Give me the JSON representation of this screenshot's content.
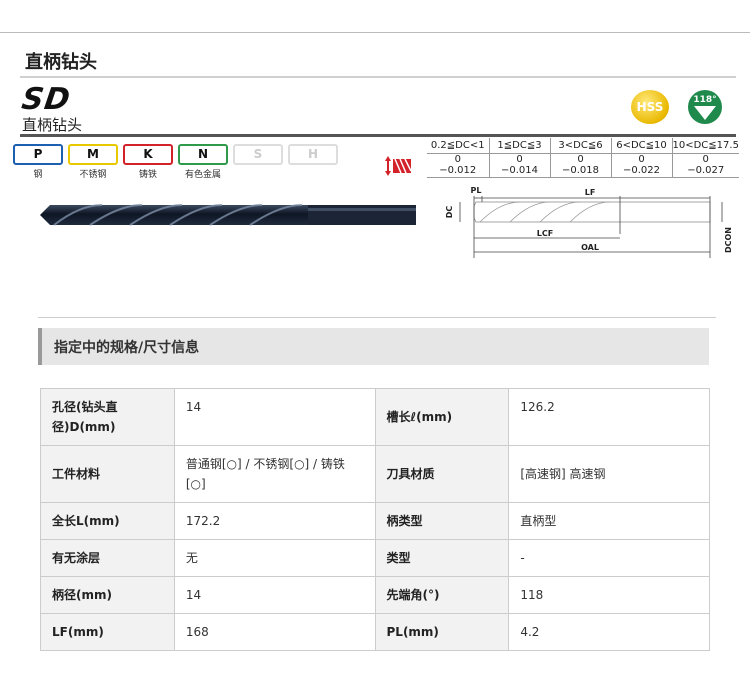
{
  "page": {
    "title": "直柄钻头"
  },
  "product": {
    "code": "SD",
    "name": "直柄钻头",
    "material_badge": "HSS",
    "point_angle_badge": "118°"
  },
  "materials": [
    {
      "code": "P",
      "label": "钢",
      "color": "#1d5fb0",
      "active": true
    },
    {
      "code": "M",
      "label": "不锈钢",
      "color": "#e8c900",
      "active": true
    },
    {
      "code": "K",
      "label": "铸铁",
      "color": "#d3222a",
      "active": true
    },
    {
      "code": "N",
      "label": "有色金属",
      "color": "#2f9a4a",
      "active": true
    },
    {
      "code": "S",
      "label": "",
      "color": "#dddddd",
      "active": false
    },
    {
      "code": "H",
      "label": "",
      "color": "#dddddd",
      "active": false
    }
  ],
  "tolerance": {
    "headers": [
      "0.2≦DC<1",
      "1≦DC≦3",
      "3<DC≦6",
      "6<DC≦10",
      "10<DC≦17.5"
    ],
    "upper": [
      "0",
      "0",
      "0",
      "0",
      "0"
    ],
    "lower": [
      "−0.012",
      "−0.014",
      "−0.018",
      "−0.022",
      "−0.027"
    ]
  },
  "diagram_labels": {
    "pl": "PL",
    "lf": "LF",
    "lcf": "LCF",
    "oal": "OAL",
    "dc": "DC",
    "dcon": "DCON"
  },
  "section": {
    "title": "指定中的规格/尺寸信息"
  },
  "specs": {
    "hole_dia_label": "孔径(钻头直径)D(mm)",
    "hole_dia_value": "14",
    "flute_len_label": "槽长ℓ(mm)",
    "flute_len_value": "126.2",
    "workpiece_label": "工件材料",
    "workpiece_value": "普通钢[○] / 不锈钢[○] / 铸铁[○]",
    "tool_material_label": "刀具材质",
    "tool_material_value": "[高速钢] 高速钢",
    "total_len_label": "全长L(mm)",
    "total_len_value": "172.2",
    "shank_type_label": "柄类型",
    "shank_type_value": "直柄型",
    "coating_label": "有无涂层",
    "coating_value": "无",
    "type_label": "类型",
    "type_value": "-",
    "shank_dia_label": "柄径(mm)",
    "shank_dia_value": "14",
    "point_angle_label": "先端角(°)",
    "point_angle_value": "118",
    "lf_label": "LF(mm)",
    "lf_value": "168",
    "pl_label": "PL(mm)",
    "pl_value": "4.2"
  }
}
